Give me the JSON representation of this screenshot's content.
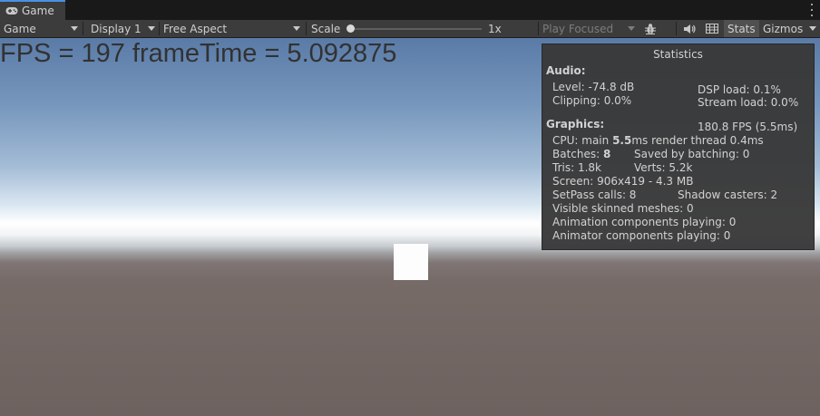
{
  "tab": {
    "label": "Game",
    "icon": "gamepad-icon"
  },
  "toolbar": {
    "view_mode": "Game",
    "display": "Display 1",
    "aspect": "Free Aspect",
    "scale_label": "Scale",
    "scale_value": "1x",
    "scale_fraction": 0,
    "play_mode": "Play Focused",
    "stats_label": "Stats",
    "gizmos_label": "Gizmos"
  },
  "game": {
    "fps_text": "FPS = 197 frameTime = 5.092875"
  },
  "stats": {
    "title": "Statistics",
    "audio_header": "Audio:",
    "level": "Level: -74.8 dB",
    "clipping": "Clipping: 0.0%",
    "dsp_load": "DSP load: 0.1%",
    "stream_load": "Stream load: 0.0%",
    "graphics_header": "Graphics:",
    "fps": "180.8 FPS (5.5ms)",
    "cpu_prefix": "CPU: main ",
    "cpu_main": "5.5",
    "cpu_suffix": "ms  render thread 0.4ms",
    "batches_prefix": "Batches: ",
    "batches": "8",
    "saved_by_batching": "Saved by batching: 0",
    "tris": "Tris: 1.8k",
    "verts": "Verts: 5.2k",
    "screen": "Screen: 906x419 - 4.3 MB",
    "setpass": "SetPass calls: 8",
    "shadow_casters": "Shadow casters: 2",
    "skinned_meshes": "Visible skinned meshes: 0",
    "animation_components": "Animation components playing: 0",
    "animator_components": "Animator components playing: 0"
  }
}
